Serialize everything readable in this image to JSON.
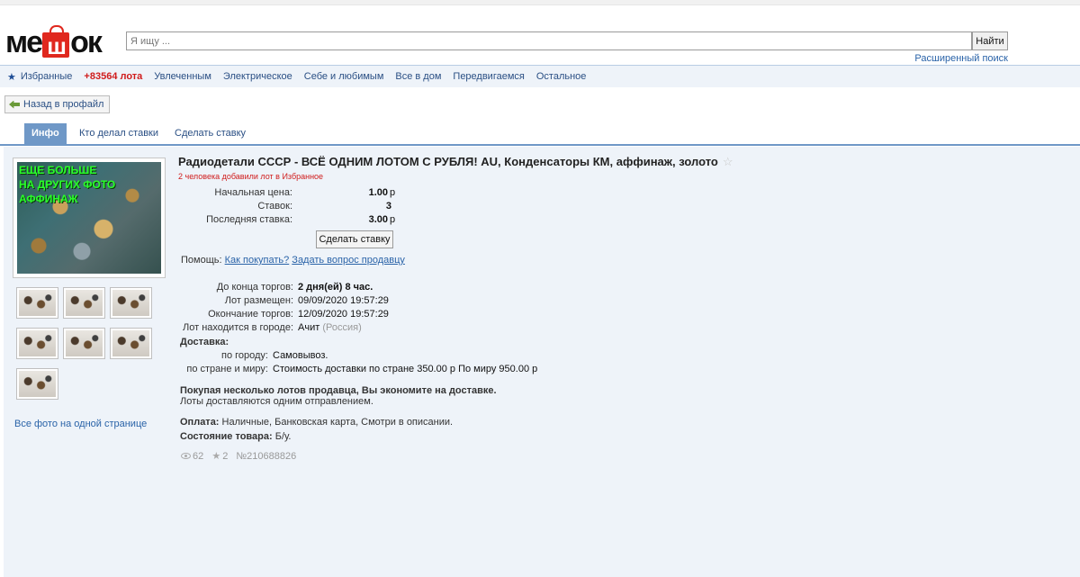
{
  "header": {
    "logo": "мешок",
    "search_placeholder": "Я ищу ...",
    "search_button": "Найти",
    "advanced_search": "Расширенный поиск"
  },
  "nav": {
    "favorites": "Избранные",
    "lots_count": "+83564 лота",
    "items": [
      "Увлеченным",
      "Электрическое",
      "Себе и любимым",
      "Все в дом",
      "Передвигаемся",
      "Остальное"
    ]
  },
  "back_button": "Назад в профайл",
  "tabs": [
    "Инфо",
    "Кто делал ставки",
    "Сделать ставку"
  ],
  "photo": {
    "overlay_text": "ЕЩЕ БОЛЬШЕ\nНА ДРУГИХ ФОТО\nАФФИНАЖ",
    "all_photos_link": "Все фото на одной странице",
    "thumb_count": 7
  },
  "lot": {
    "title": "Радиодетали СССР - ВСЁ ОДНИМ ЛОТОМ С РУБЛЯ! AU, Конденсаторы КМ, аффинаж, золото",
    "favorites_note": "2 человека добавили лот в Избранное",
    "start_price_label": "Начальная цена:",
    "start_price": "1.00",
    "bids_label": "Ставок:",
    "bids": "3",
    "last_bid_label": "Последняя ставка:",
    "last_bid": "3.00",
    "currency": "р",
    "bid_button": "Сделать ставку",
    "help_label": "Помощь:",
    "help_how_to_buy": "Как покупать?",
    "help_ask_seller": "Задать вопрос продавцу",
    "ends_in_label": "До конца торгов:",
    "ends_in": "2 дня(ей) 8 час.",
    "posted_label": "Лот размещен:",
    "posted": "09/09/2020 19:57:29",
    "end_label": "Окончание торгов:",
    "end": "12/09/2020 19:57:29",
    "city_label": "Лот находится в городе:",
    "city": "Ачит",
    "country": "(Россия)",
    "delivery_label": "Доставка:",
    "delivery_city_label": "по городу:",
    "delivery_city": "Самовывоз.",
    "delivery_country_label": "по стране и миру:",
    "delivery_country": "Стоимость доставки по стране 350.00 р По миру 950.00 р",
    "multi_lot_note": "Покупая несколько лотов продавца, Вы экономите на доставке.",
    "multi_lot_sub": "Лоты доставляются одним отправлением.",
    "payment_label": "Оплата:",
    "payment": "Наличные, Банковская карта, Смотри в описании.",
    "condition_label": "Состояние товара:",
    "condition": "Б/у.",
    "views": "62",
    "stars": "2",
    "lot_number": "№210688826"
  }
}
